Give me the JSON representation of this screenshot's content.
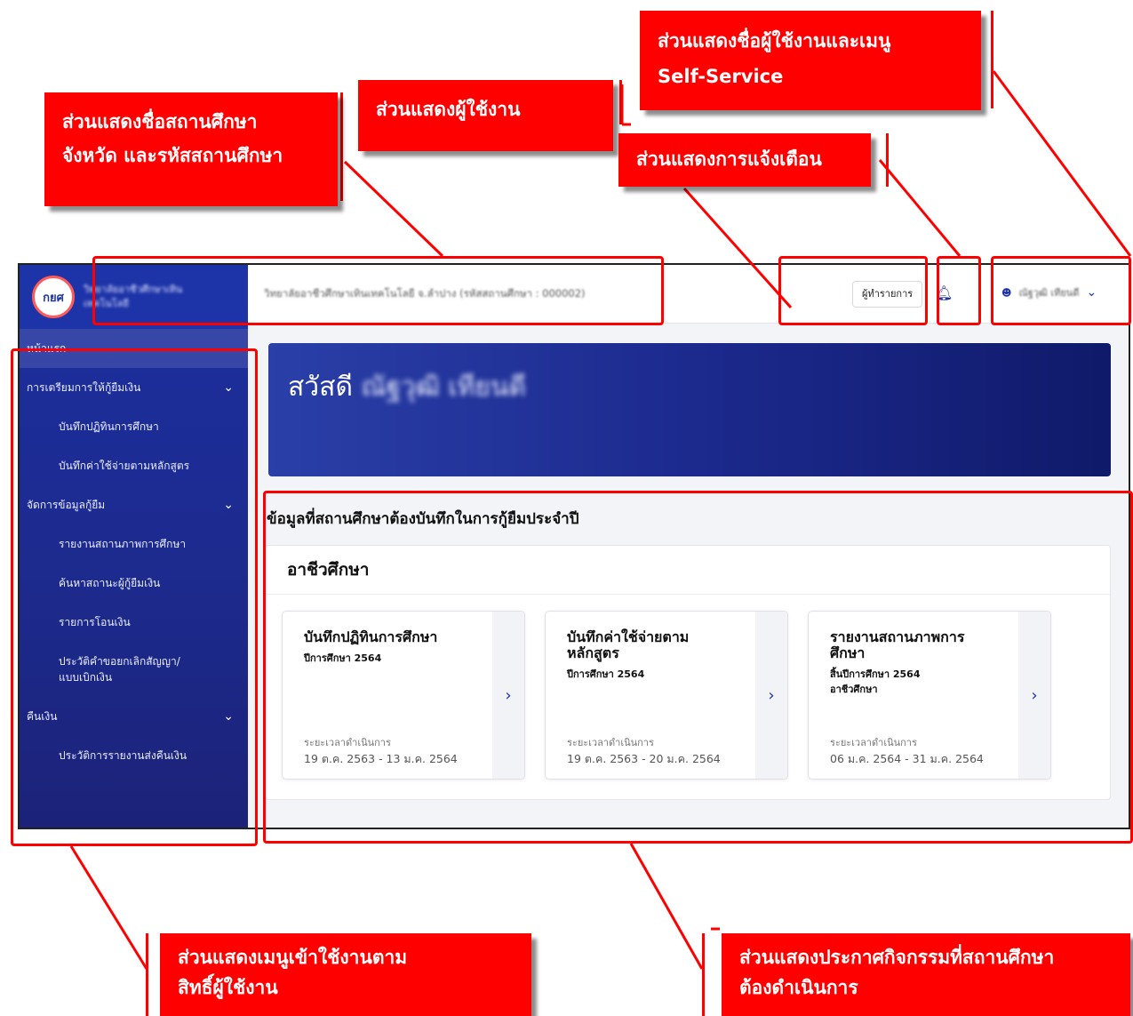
{
  "callouts": {
    "school_info": [
      "ส่วนแสดงชื่อสถานศึกษา",
      "จังหวัด และรหัสสถานศึกษา"
    ],
    "user_role": [
      "ส่วนแสดงผู้ใช้งาน"
    ],
    "notification": [
      "ส่วนแสดงการแจ้งเตือน"
    ],
    "user_menu": [
      "ส่วนแสดงชื่อผู้ใช้งานและเมนู",
      "Self-Service"
    ],
    "sidebar_menu": [
      "ส่วนแสดงเมนูเข้าใช้งานตาม",
      "สิทธิ์ผู้ใช้งาน"
    ],
    "activities": [
      "ส่วนแสดงประกาศกิจกรรมที่สถานศึกษา",
      "ต้องดำเนินการ"
    ]
  },
  "app": {
    "logo_text": "กยศ",
    "logo_name": "วิทยาลัยอาชีวศึกษาเทิน เทคโนโลยี",
    "school_line": "วิทยาลัยอาชีวศึกษาเทินเทคโนโลยี จ.ลำปาง (รหัสสถานศึกษา : 000002)",
    "role_label": "ผู้ทำรายการ",
    "user_name": "ณัฐวุฒิ เทียนดี",
    "sidebar": {
      "home": "หน้าแรก",
      "groups": [
        {
          "label": "การเตรียมการให้กู้ยืมเงิน",
          "items": [
            "บันทึกปฏิทินการศึกษา",
            "บันทึกค่าใช้จ่ายตามหลักสูตร"
          ]
        },
        {
          "label": "จัดการข้อมูลกู้ยืม",
          "items": [
            "รายงานสถานภาพการศึกษา",
            "ค้นหาสถานะผู้กู้ยืมเงิน",
            "รายการโอนเงิน",
            "ประวัติคำขอยกเลิกสัญญา/แบบเบิกเงิน"
          ]
        },
        {
          "label": "คืนเงิน",
          "items": [
            "ประวัติการรายงานส่งคืนเงิน"
          ]
        }
      ]
    },
    "banner": {
      "greeting": "สวัสดี",
      "name": "ณัฐวุฒิ เทียนดี"
    },
    "section_title": "ข้อมูลที่สถานศึกษาต้องบันทึกในการกู้ยืมประจำปี",
    "panel_title": "อาชีวศึกษา",
    "cards": [
      {
        "title": "บันทึกปฏิทินการศึกษา",
        "lines": [
          "ปีการศึกษา 2564"
        ],
        "period_label": "ระยะเวลาดำเนินการ",
        "period": "19 ต.ค. 2563 - 13 ม.ค. 2564"
      },
      {
        "title": "บันทึกค่าใช้จ่ายตาม หลักสูตร",
        "lines": [
          "ปีการศึกษา 2564"
        ],
        "period_label": "ระยะเวลาดำเนินการ",
        "period": "19 ต.ค. 2563 - 20 ม.ค. 2564"
      },
      {
        "title": "รายงานสถานภาพการ ศึกษา",
        "lines": [
          "สิ้นปีการศึกษา 2564",
          "อาชีวศึกษา"
        ],
        "period_label": "ระยะเวลาดำเนินการ",
        "period": "06 ม.ค. 2564 - 31 ม.ค. 2564"
      }
    ]
  },
  "icons": {
    "bell": "bell-icon",
    "user": "user-icon",
    "chevron": "chevron-down-icon",
    "arrow": "chevron-right-icon"
  },
  "colors": {
    "callout": "#ff0000",
    "primary": "#1d33a8"
  }
}
